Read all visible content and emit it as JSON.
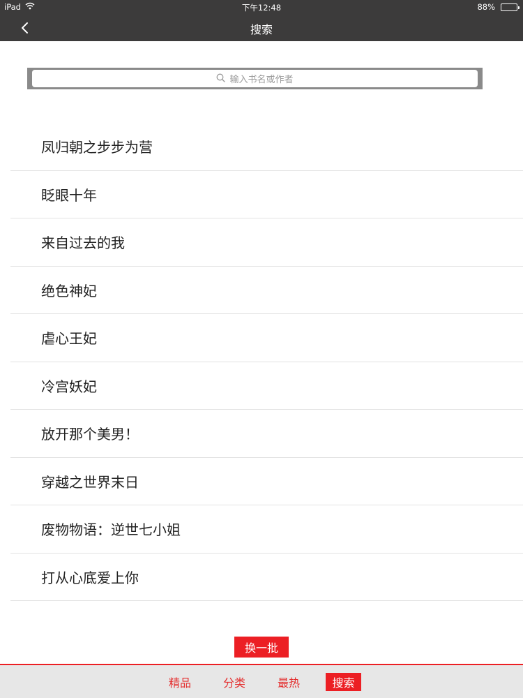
{
  "status_bar": {
    "carrier": "iPad",
    "time": "下午12:48",
    "battery": "88%",
    "battery_level": 0.88
  },
  "nav": {
    "title": "搜索",
    "back_icon": "chevron-left-icon"
  },
  "search": {
    "placeholder": "输入书名或作者",
    "icon": "search-icon"
  },
  "books": [
    "凤归朝之步步为营",
    "眨眼十年",
    "来自过去的我",
    "绝色神妃",
    "虐心王妃",
    "冷宫妖妃",
    "放开那个美男！",
    "穿越之世界末日",
    "废物物语：逆世七小姐",
    "打从心底爱上你"
  ],
  "refresh_label": "换一批",
  "tabs": [
    {
      "label": "精品",
      "active": false
    },
    {
      "label": "分类",
      "active": false
    },
    {
      "label": "最热",
      "active": false
    },
    {
      "label": "搜索",
      "active": true
    }
  ],
  "colors": {
    "accent": "#ec1f24",
    "topbar": "#3c3b3b",
    "tabbar_bg": "#e7e7e7"
  }
}
